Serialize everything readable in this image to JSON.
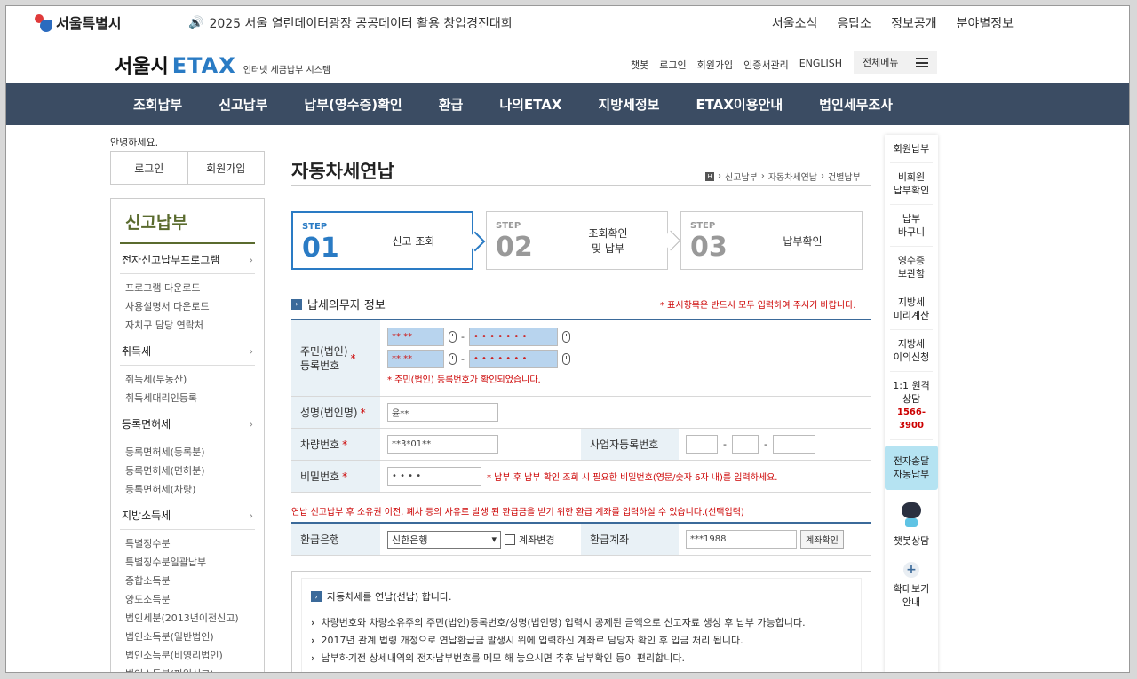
{
  "topbar": {
    "logo_text": "서울특별시",
    "notice_icon": "speaker-icon",
    "notice": "2025 서울 열린데이터광장 공공데이터 활용 창업경진대회",
    "links": [
      "서울소식",
      "응답소",
      "정보공개",
      "분야별정보"
    ]
  },
  "header": {
    "logo_main": "서울시",
    "logo_etax": "ETAX",
    "logo_sub": "인터넷 세금납부 시스템",
    "util_links": [
      "챗봇",
      "로그인",
      "회원가입",
      "인증서관리",
      "ENGLISH"
    ],
    "all_menu": "전체메뉴"
  },
  "gnb": [
    "조회납부",
    "신고납부",
    "납부(영수증)확인",
    "환급",
    "나의ETAX",
    "지방세정보",
    "ETAX이용안내",
    "법인세무조사"
  ],
  "sidebar": {
    "greeting": "안녕하세요.",
    "login": "로그인",
    "signup": "회원가입",
    "title": "신고납부",
    "groups": [
      {
        "head": "전자신고납부프로그램",
        "subs": [
          "프로그램 다운로드",
          "사용설명서 다운로드",
          "자치구 담당 연락처"
        ]
      },
      {
        "head": "취득세",
        "subs": [
          "취득세(부동산)",
          "취득세대리인등록"
        ]
      },
      {
        "head": "등록면허세",
        "subs": [
          "등록면허세(등록분)",
          "등록면허세(면허분)",
          "등록면허세(차량)"
        ]
      },
      {
        "head": "지방소득세",
        "subs": [
          "특별징수분",
          "특별징수분일괄납부",
          "종합소득분",
          "양도소득분",
          "법인세분(2013년이전신고)",
          "법인소득분(일반법인)",
          "법인소득분(비영리법인)",
          "법인소득분(파일신고)"
        ]
      }
    ]
  },
  "content": {
    "title": "자동차세연납",
    "breadcrumb": [
      "신고납부",
      "자동차세연납",
      "건별납부"
    ],
    "steps": [
      {
        "label": "STEP",
        "num": "01",
        "text": "신고 조회"
      },
      {
        "label": "STEP",
        "num": "02",
        "text": "조회확인\n및 납부"
      },
      {
        "label": "STEP",
        "num": "03",
        "text": "납부확인"
      }
    ],
    "section_title": "납세의무자 정보",
    "required_note": "* 표시항목은 반드시 모두 입력하여 주시기 바랍니다.",
    "rrn_label": "주민(법인)\n등록번호",
    "rrn1_front": "**  **",
    "rrn1_back": "• • • • • • •",
    "rrn2_front": "** **",
    "rrn2_back": "• • • • • • •",
    "dash": "-",
    "rrn_confirm": "* 주민(법인) 등록번호가 확인되었습니다.",
    "name_label": "성명(법인명)",
    "name_value": "윤**",
    "car_label": "차량번호",
    "car_value": "**3*01**",
    "biz_label": "사업자등록번호",
    "pw_label": "비밀번호",
    "pw_value": "• • • •",
    "pw_note": "* 납부 후 납부 확인 조회 시 필요한 비밀번호(영문/숫자 6자 내)를 입력하세요.",
    "star": "*",
    "refund_note": "연납 신고납부 후 소유권 이전, 폐차 등의 사유로 발생 된 환급금을 받기 위한 환급 계좌를 입력하실 수 있습니다.(선택입력)",
    "bank_label": "환급은행",
    "bank_value": "신한은행",
    "account_change": "계좌변경",
    "account_label": "환급계좌",
    "account_value": "***1988",
    "account_check": "계좌확인",
    "info_head": "자동차세를 연납(선납) 합니다.",
    "info_items": [
      "차량번호와 차량소유주의 주민(법인)등록번호/성명(법인명) 입력시 공제된 금액으로 신고자료 생성 후 납부 가능합니다.",
      "2017년 관계 법령 개정으로 연납환급금 발생시 위에 입력하신 계좌로 담당자 확인 후 입금 처리 됩니다.",
      "납부하기전 상세내역의 전자납부번호를 메모 해 놓으시면 추후 납부확인 등이 편리합니다."
    ]
  },
  "quick": {
    "items": [
      "회원납부",
      "비회원\n납부확인",
      "납부\n바구니",
      "영수증\n보관함",
      "지방세\n미리계산",
      "지방세\n이의신청"
    ],
    "consult": "1:1 원격\n상담",
    "tel": "1566-3900",
    "highlight": "전자송달\n자동납부",
    "chatbot": "챗봇상담",
    "zoom": "확대보기\n안내"
  },
  "colors": {
    "gnb_bg": "#3b4c63",
    "accent": "#2a7bc4",
    "warn": "#cc0000",
    "lnb_title": "#5a6b2e"
  }
}
